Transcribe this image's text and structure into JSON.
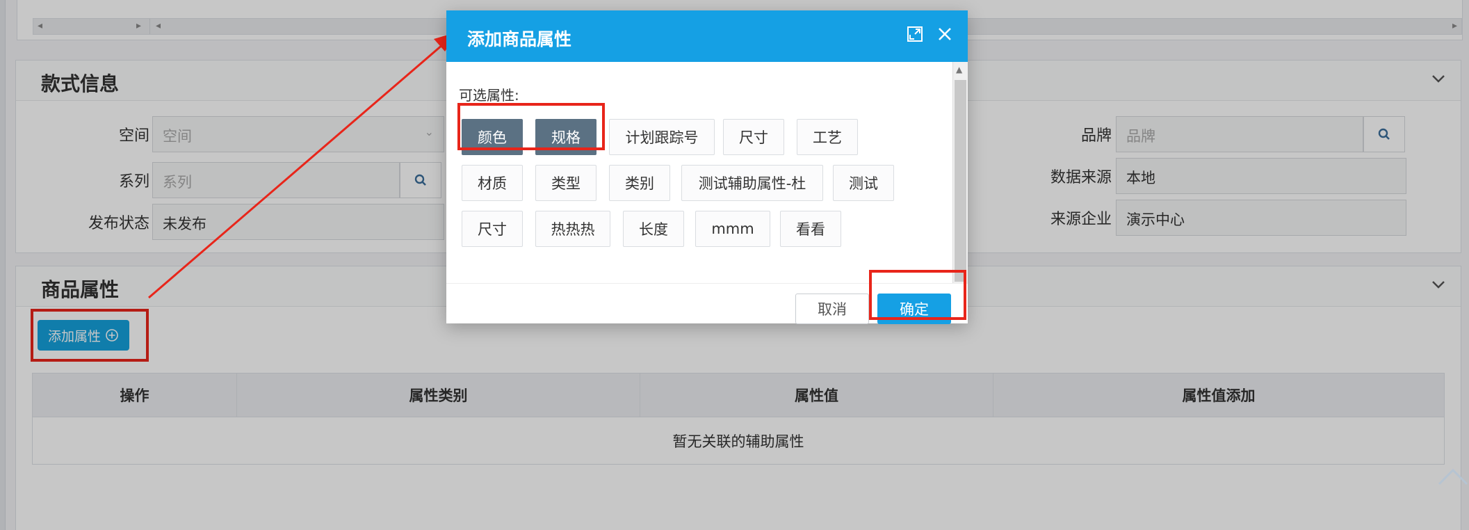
{
  "style_section": {
    "title": "款式信息",
    "fields": {
      "space": {
        "label": "空间",
        "placeholder": "空间"
      },
      "series": {
        "label": "系列",
        "placeholder": "系列"
      },
      "publish_status": {
        "label": "发布状态",
        "value": "未发布"
      },
      "brand": {
        "label": "品牌",
        "placeholder": "品牌"
      },
      "data_source": {
        "label": "数据来源",
        "value": "本地"
      },
      "source_company": {
        "label": "来源企业",
        "value": "演示中心"
      }
    }
  },
  "attr_section": {
    "title": "商品属性",
    "add_button": "添加属性",
    "table": {
      "headers": [
        "操作",
        "属性类别",
        "属性值",
        "属性值添加"
      ],
      "empty_text": "暂无关联的辅助属性"
    }
  },
  "modal": {
    "title": "添加商品属性",
    "options_label": "可选属性:",
    "tags": [
      {
        "label": "颜色",
        "selected": true
      },
      {
        "label": "规格",
        "selected": true
      },
      {
        "label": "计划跟踪号",
        "selected": false
      },
      {
        "label": "尺寸",
        "selected": false
      },
      {
        "label": "工艺",
        "selected": false
      },
      {
        "label": "材质",
        "selected": false
      },
      {
        "label": "类型",
        "selected": false
      },
      {
        "label": "类别",
        "selected": false
      },
      {
        "label": "测试辅助属性-杜",
        "selected": false
      },
      {
        "label": "测试",
        "selected": false
      },
      {
        "label": "尺寸",
        "selected": false
      },
      {
        "label": "热热热",
        "selected": false
      },
      {
        "label": "长度",
        "selected": false
      },
      {
        "label": "mmm",
        "selected": false
      },
      {
        "label": "看看",
        "selected": false
      }
    ],
    "cancel_label": "取消",
    "confirm_label": "确定"
  },
  "colors": {
    "primary": "#15a0e4",
    "selected_tag": "#5b7183",
    "highlight": "#e8251a"
  },
  "icons": {
    "maximize": "maximize-icon",
    "close": "close-icon",
    "search": "search-icon",
    "add_circle": "plus-circle-icon",
    "collapse": "chevron-down-icon",
    "back_to_top": "chevron-up-icon"
  }
}
